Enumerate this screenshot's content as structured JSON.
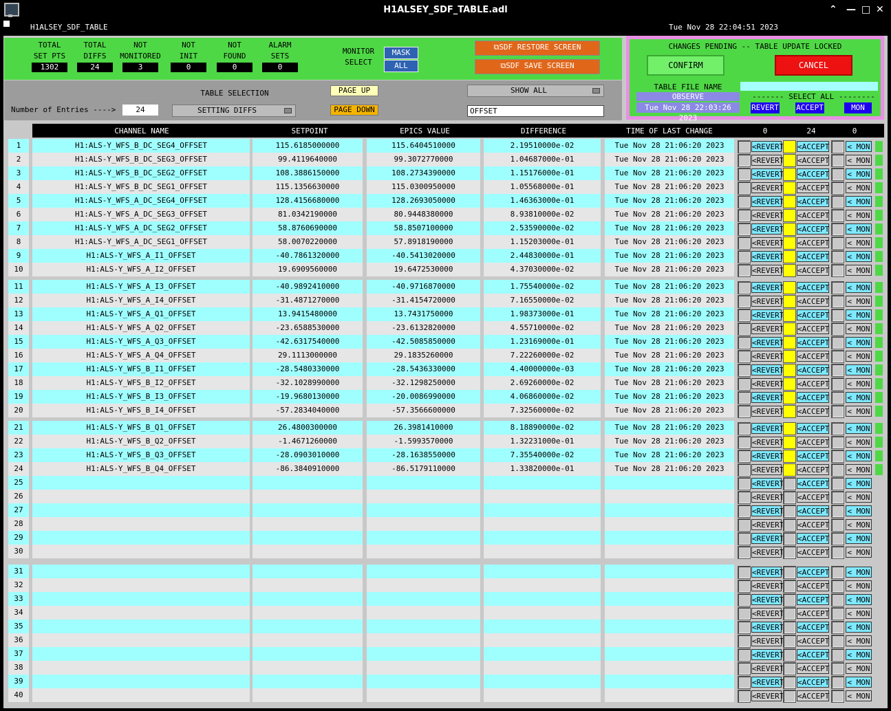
{
  "window": {
    "title": "H1ALSEY_SDF_TABLE.adl"
  },
  "subbar": {
    "name": "H1ALSEY_SDF_TABLE",
    "datetime": "Tue Nov 28 22:04:51 2023"
  },
  "summary": [
    {
      "label": "TOTAL SET PTS",
      "value": "1302"
    },
    {
      "label": "TOTAL DIFFS",
      "value": "24"
    },
    {
      "label": "NOT MONITORED",
      "value": "3"
    },
    {
      "label": "NOT INIT",
      "value": "0"
    },
    {
      "label": "NOT FOUND",
      "value": "0"
    },
    {
      "label": "ALARM SETS",
      "value": "0"
    }
  ],
  "monitor": {
    "label": "MONITOR SELECT",
    "mask": "MASK",
    "all": "ALL"
  },
  "screens": {
    "restore": "SDF RESTORE SCREEN",
    "save": "SDF SAVE SCREEN"
  },
  "changes": {
    "header": "CHANGES PENDING -- TABLE UPDATE LOCKED",
    "confirm": "CONFIRM",
    "cancel": "CANCEL",
    "file_label": "TABLE FILE NAME",
    "file_value": "",
    "observe": "OBSERVE",
    "file_time": "Tue Nov 28 22:03:26 2023",
    "select_all": "------- SELECT ALL --------",
    "revert": "REVERT",
    "accept": "ACCEPT",
    "mon": "MON"
  },
  "controls": {
    "table_selection_label": "TABLE SELECTION",
    "entries_label": "Number of Entries ---->",
    "entries_value": "24",
    "selection": "SETTING DIFFS",
    "page_up": "PAGE UP",
    "page_down": "PAGE DOWN",
    "show": "SHOW ALL",
    "filter": "OFFSET"
  },
  "columns": {
    "channel": "CHANNEL NAME",
    "setpoint": "SETPOINT",
    "epics": "EPICS VALUE",
    "difference": "DIFFERENCE",
    "time": "TIME OF LAST CHANGE",
    "count_revert": "0",
    "count_accept": "24",
    "count_mon": "0"
  },
  "row_buttons": {
    "revert": "<REVERT",
    "accept": "<ACCEPT",
    "mon": "< MON"
  },
  "rows": [
    {
      "n": "1",
      "channel": "H1:ALS-Y_WFS_B_DC_SEG4_OFFSET",
      "setpoint": "115.6185000000",
      "epics": "115.6404510000",
      "diff": "2.19510000e-02",
      "time": "Tue Nov 28 21:06:20 2023"
    },
    {
      "n": "2",
      "channel": "H1:ALS-Y_WFS_B_DC_SEG3_OFFSET",
      "setpoint": "99.4119640000",
      "epics": "99.3072770000",
      "diff": "1.04687000e-01",
      "time": "Tue Nov 28 21:06:20 2023"
    },
    {
      "n": "3",
      "channel": "H1:ALS-Y_WFS_B_DC_SEG2_OFFSET",
      "setpoint": "108.3886150000",
      "epics": "108.2734390000",
      "diff": "1.15176000e-01",
      "time": "Tue Nov 28 21:06:20 2023"
    },
    {
      "n": "4",
      "channel": "H1:ALS-Y_WFS_B_DC_SEG1_OFFSET",
      "setpoint": "115.1356630000",
      "epics": "115.0300950000",
      "diff": "1.05568000e-01",
      "time": "Tue Nov 28 21:06:20 2023"
    },
    {
      "n": "5",
      "channel": "H1:ALS-Y_WFS_A_DC_SEG4_OFFSET",
      "setpoint": "128.4156680000",
      "epics": "128.2693050000",
      "diff": "1.46363000e-01",
      "time": "Tue Nov 28 21:06:20 2023"
    },
    {
      "n": "6",
      "channel": "H1:ALS-Y_WFS_A_DC_SEG3_OFFSET",
      "setpoint": "81.0342190000",
      "epics": "80.9448380000",
      "diff": "8.93810000e-02",
      "time": "Tue Nov 28 21:06:20 2023"
    },
    {
      "n": "7",
      "channel": "H1:ALS-Y_WFS_A_DC_SEG2_OFFSET",
      "setpoint": "58.8760690000",
      "epics": "58.8507100000",
      "diff": "2.53590000e-02",
      "time": "Tue Nov 28 21:06:20 2023"
    },
    {
      "n": "8",
      "channel": "H1:ALS-Y_WFS_A_DC_SEG1_OFFSET",
      "setpoint": "58.0070220000",
      "epics": "57.8918190000",
      "diff": "1.15203000e-01",
      "time": "Tue Nov 28 21:06:20 2023"
    },
    {
      "n": "9",
      "channel": "H1:ALS-Y_WFS_A_I1_OFFSET",
      "setpoint": "-40.7861320000",
      "epics": "-40.5413020000",
      "diff": "2.44830000e-01",
      "time": "Tue Nov 28 21:06:20 2023"
    },
    {
      "n": "10",
      "channel": "H1:ALS-Y_WFS_A_I2_OFFSET",
      "setpoint": "19.6909560000",
      "epics": "19.6472530000",
      "diff": "4.37030000e-02",
      "time": "Tue Nov 28 21:06:20 2023"
    },
    {
      "n": "11",
      "channel": "H1:ALS-Y_WFS_A_I3_OFFSET",
      "setpoint": "-40.9892410000",
      "epics": "-40.9716870000",
      "diff": "1.75540000e-02",
      "time": "Tue Nov 28 21:06:20 2023"
    },
    {
      "n": "12",
      "channel": "H1:ALS-Y_WFS_A_I4_OFFSET",
      "setpoint": "-31.4871270000",
      "epics": "-31.4154720000",
      "diff": "7.16550000e-02",
      "time": "Tue Nov 28 21:06:20 2023"
    },
    {
      "n": "13",
      "channel": "H1:ALS-Y_WFS_A_Q1_OFFSET",
      "setpoint": "13.9415480000",
      "epics": "13.7431750000",
      "diff": "1.98373000e-01",
      "time": "Tue Nov 28 21:06:20 2023"
    },
    {
      "n": "14",
      "channel": "H1:ALS-Y_WFS_A_Q2_OFFSET",
      "setpoint": "-23.6588530000",
      "epics": "-23.6132820000",
      "diff": "4.55710000e-02",
      "time": "Tue Nov 28 21:06:20 2023"
    },
    {
      "n": "15",
      "channel": "H1:ALS-Y_WFS_A_Q3_OFFSET",
      "setpoint": "-42.6317540000",
      "epics": "-42.5085850000",
      "diff": "1.23169000e-01",
      "time": "Tue Nov 28 21:06:20 2023"
    },
    {
      "n": "16",
      "channel": "H1:ALS-Y_WFS_A_Q4_OFFSET",
      "setpoint": "29.1113000000",
      "epics": "29.1835260000",
      "diff": "7.22260000e-02",
      "time": "Tue Nov 28 21:06:20 2023"
    },
    {
      "n": "17",
      "channel": "H1:ALS-Y_WFS_B_I1_OFFSET",
      "setpoint": "-28.5480330000",
      "epics": "-28.5436330000",
      "diff": "4.40000000e-03",
      "time": "Tue Nov 28 21:06:20 2023"
    },
    {
      "n": "18",
      "channel": "H1:ALS-Y_WFS_B_I2_OFFSET",
      "setpoint": "-32.1028990000",
      "epics": "-32.1298250000",
      "diff": "2.69260000e-02",
      "time": "Tue Nov 28 21:06:20 2023"
    },
    {
      "n": "19",
      "channel": "H1:ALS-Y_WFS_B_I3_OFFSET",
      "setpoint": "-19.9680130000",
      "epics": "-20.0086990000",
      "diff": "4.06860000e-02",
      "time": "Tue Nov 28 21:06:20 2023"
    },
    {
      "n": "20",
      "channel": "H1:ALS-Y_WFS_B_I4_OFFSET",
      "setpoint": "-57.2834040000",
      "epics": "-57.3566600000",
      "diff": "7.32560000e-02",
      "time": "Tue Nov 28 21:06:20 2023"
    },
    {
      "n": "21",
      "channel": "H1:ALS-Y_WFS_B_Q1_OFFSET",
      "setpoint": "26.4800300000",
      "epics": "26.3981410000",
      "diff": "8.18890000e-02",
      "time": "Tue Nov 28 21:06:20 2023"
    },
    {
      "n": "22",
      "channel": "H1:ALS-Y_WFS_B_Q2_OFFSET",
      "setpoint": "-1.4671260000",
      "epics": "-1.5993570000",
      "diff": "1.32231000e-01",
      "time": "Tue Nov 28 21:06:20 2023"
    },
    {
      "n": "23",
      "channel": "H1:ALS-Y_WFS_B_Q3_OFFSET",
      "setpoint": "-28.0903010000",
      "epics": "-28.1638550000",
      "diff": "7.35540000e-02",
      "time": "Tue Nov 28 21:06:20 2023"
    },
    {
      "n": "24",
      "channel": "H1:ALS-Y_WFS_B_Q4_OFFSET",
      "setpoint": "-86.3840910000",
      "epics": "-86.5179110000",
      "diff": "1.33820000e-01",
      "time": "Tue Nov 28 21:06:20 2023"
    },
    {
      "n": "25",
      "channel": "",
      "setpoint": "",
      "epics": "",
      "diff": "",
      "time": ""
    },
    {
      "n": "26",
      "channel": "",
      "setpoint": "",
      "epics": "",
      "diff": "",
      "time": ""
    },
    {
      "n": "27",
      "channel": "",
      "setpoint": "",
      "epics": "",
      "diff": "",
      "time": ""
    },
    {
      "n": "28",
      "channel": "",
      "setpoint": "",
      "epics": "",
      "diff": "",
      "time": ""
    },
    {
      "n": "29",
      "channel": "",
      "setpoint": "",
      "epics": "",
      "diff": "",
      "time": ""
    },
    {
      "n": "30",
      "channel": "",
      "setpoint": "",
      "epics": "",
      "diff": "",
      "time": ""
    },
    {
      "n": "31",
      "channel": "",
      "setpoint": "",
      "epics": "",
      "diff": "",
      "time": ""
    },
    {
      "n": "32",
      "channel": "",
      "setpoint": "",
      "epics": "",
      "diff": "",
      "time": ""
    },
    {
      "n": "33",
      "channel": "",
      "setpoint": "",
      "epics": "",
      "diff": "",
      "time": ""
    },
    {
      "n": "34",
      "channel": "",
      "setpoint": "",
      "epics": "",
      "diff": "",
      "time": ""
    },
    {
      "n": "35",
      "channel": "",
      "setpoint": "",
      "epics": "",
      "diff": "",
      "time": ""
    },
    {
      "n": "36",
      "channel": "",
      "setpoint": "",
      "epics": "",
      "diff": "",
      "time": ""
    },
    {
      "n": "37",
      "channel": "",
      "setpoint": "",
      "epics": "",
      "diff": "",
      "time": ""
    },
    {
      "n": "38",
      "channel": "",
      "setpoint": "",
      "epics": "",
      "diff": "",
      "time": ""
    },
    {
      "n": "39",
      "channel": "",
      "setpoint": "",
      "epics": "",
      "diff": "",
      "time": ""
    },
    {
      "n": "40",
      "channel": "",
      "setpoint": "",
      "epics": "",
      "diff": "",
      "time": ""
    }
  ],
  "colors": {
    "row_cyan": "#9fffff",
    "row_grey": "#e6e6e6",
    "panel_green": "#4fd846",
    "accent_yellow": "#ffff00"
  }
}
